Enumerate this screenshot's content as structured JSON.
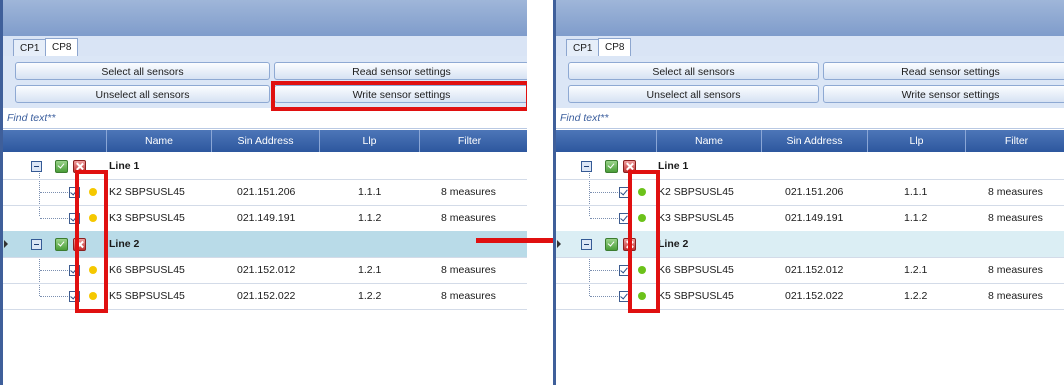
{
  "tabs": [
    "CP1",
    "CP8"
  ],
  "buttons": {
    "select_all": "Select all sensors",
    "read_settings": "Read sensor settings",
    "unselect_all": "Unselect all sensors",
    "write_settings": "Write sensor settings"
  },
  "find_placeholder": "Find text**",
  "columns": [
    "Name",
    "Sin Address",
    "Llp",
    "Filter"
  ],
  "groups": [
    {
      "name": "Line 1",
      "sensors": [
        {
          "name": "K2 SBPSUSL45",
          "address": "021.151.206",
          "llp": "1.1.1",
          "filter": "8 measures"
        },
        {
          "name": "K3 SBPSUSL45",
          "address": "021.149.191",
          "llp": "1.1.2",
          "filter": "8 measures"
        }
      ]
    },
    {
      "name": "Line 2",
      "sensors": [
        {
          "name": "K6 SBPSUSL45",
          "address": "021.152.012",
          "llp": "1.2.1",
          "filter": "8 measures"
        },
        {
          "name": "K5 SBPSUSL45",
          "address": "021.152.022",
          "llp": "1.2.2",
          "filter": "8 measures"
        }
      ]
    }
  ],
  "colors": {
    "status_before": "#f5c800",
    "status_after": "#6cc21a",
    "highlight": "#e01010"
  },
  "icons": {
    "status_before": "yellow-status-dot-icon",
    "status_after": "green-status-dot-icon"
  }
}
